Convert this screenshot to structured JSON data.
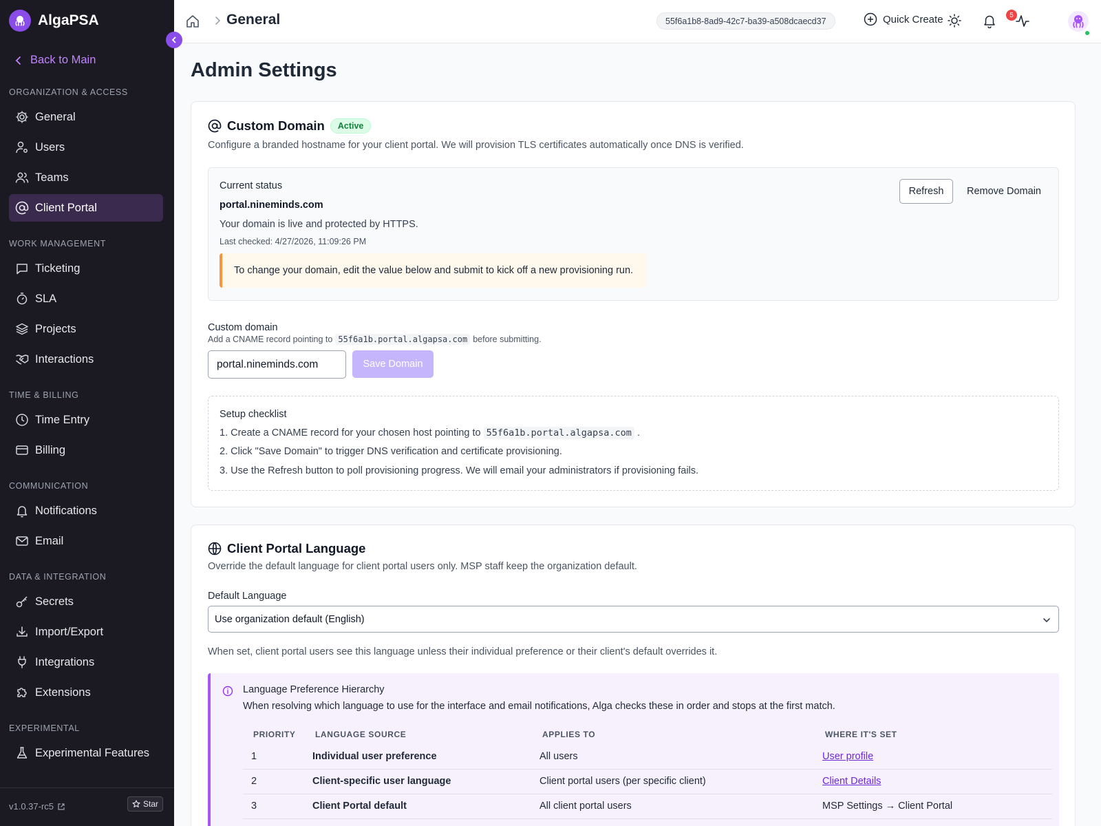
{
  "app": {
    "name": "AlgaPSA",
    "version": "v1.0.37-rc5",
    "star_label": "Star"
  },
  "sidebar": {
    "back_label": "Back to Main",
    "sections": [
      {
        "label": "ORGANIZATION & ACCESS",
        "items": [
          "General",
          "Users",
          "Teams",
          "Client Portal"
        ]
      },
      {
        "label": "WORK MANAGEMENT",
        "items": [
          "Ticketing",
          "SLA",
          "Projects",
          "Interactions"
        ]
      },
      {
        "label": "TIME & BILLING",
        "items": [
          "Time Entry",
          "Billing"
        ]
      },
      {
        "label": "COMMUNICATION",
        "items": [
          "Notifications",
          "Email"
        ]
      },
      {
        "label": "DATA & INTEGRATION",
        "items": [
          "Secrets",
          "Import/Export",
          "Integrations",
          "Extensions"
        ]
      },
      {
        "label": "EXPERIMENTAL",
        "items": [
          "Experimental Features"
        ]
      }
    ],
    "active_item": "Client Portal"
  },
  "header": {
    "breadcrumb_title": "General",
    "tenant_id": "55f6a1b8-8ad9-42c7-ba39-a508dcaecd37",
    "quick_create_label": "Quick Create",
    "notification_count": "5"
  },
  "page": {
    "title": "Admin Settings"
  },
  "custom_domain": {
    "title": "Custom Domain",
    "badge": "Active",
    "description": "Configure a branded hostname for your client portal. We will provision TLS certificates automatically once DNS is verified.",
    "status_label": "Current status",
    "domain": "portal.nineminds.com",
    "live_text": "Your domain is live and protected by HTTPS.",
    "last_checked": "Last checked: 4/27/2026, 11:09:26 PM",
    "notice": "To change your domain, edit the value below and submit to kick off a new provisioning run.",
    "refresh_label": "Refresh",
    "remove_label": "Remove Domain",
    "field_label": "Custom domain",
    "help_prefix": "Add a CNAME record pointing to",
    "cname_target": "55f6a1b.portal.algapsa.com",
    "help_suffix": "before submitting.",
    "input_value": "portal.nineminds.com",
    "save_label": "Save Domain",
    "checklist_title": "Setup checklist",
    "checklist_1_prefix": "1. Create a CNAME record for your chosen host pointing to",
    "checklist_1_suffix": ".",
    "checklist_2": "2. Click \"Save Domain\" to trigger DNS verification and certificate provisioning.",
    "checklist_3": "3. Use the Refresh button to poll provisioning progress. We will email your administrators if provisioning fails."
  },
  "language": {
    "title": "Client Portal Language",
    "description": "Override the default language for client portal users only. MSP staff keep the organization default.",
    "field_label": "Default Language",
    "selected": "Use organization default (English)",
    "help": "When set, client portal users see this language unless their individual preference or their client's default overrides it.",
    "info_title": "Language Preference Hierarchy",
    "info_desc": "When resolving which language to use for the interface and email notifications, Alga checks these in order and stops at the first match.",
    "columns": [
      "PRIORITY",
      "LANGUAGE SOURCE",
      "APPLIES TO",
      "WHERE IT'S SET"
    ],
    "rows": [
      {
        "priority": "1",
        "source": "Individual user preference",
        "applies": "All users",
        "where": "User profile",
        "link": true
      },
      {
        "priority": "2",
        "source": "Client-specific user language",
        "applies": "Client portal users (per specific client)",
        "where": "Client Details",
        "link": true
      },
      {
        "priority": "3",
        "source": "Client Portal default",
        "applies": "All client portal users",
        "where": "MSP Settings → Client Portal",
        "link": false
      }
    ]
  }
}
